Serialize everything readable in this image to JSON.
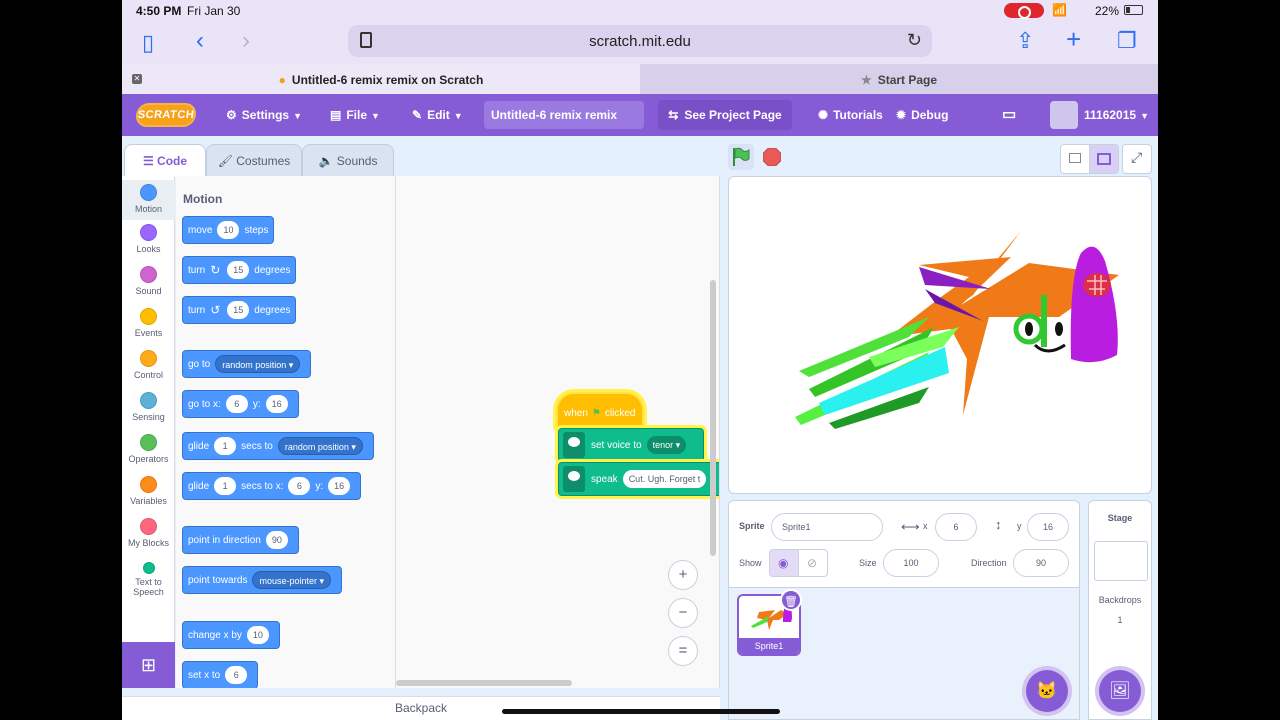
{
  "status": {
    "time": "4:50 PM",
    "date": "Fri Jan 30",
    "battery": "22%"
  },
  "browser": {
    "url": "scratch.mit.edu",
    "tabs": [
      {
        "label": "Untitled-6 remix remix on Scratch",
        "active": true
      },
      {
        "label": "Start Page",
        "active": false
      }
    ]
  },
  "menubar": {
    "logo": "SCRATCH",
    "settings": "Settings",
    "file": "File",
    "edit": "Edit",
    "project_title": "Untitled-6 remix remix",
    "see_project": "See Project Page",
    "tutorials": "Tutorials",
    "debug": "Debug",
    "username": "11162015"
  },
  "editor_tabs": {
    "code": "Code",
    "costumes": "Costumes",
    "sounds": "Sounds"
  },
  "categories": [
    {
      "label": "Motion",
      "color": "#4c97ff"
    },
    {
      "label": "Looks",
      "color": "#9966ff"
    },
    {
      "label": "Sound",
      "color": "#cf63cf"
    },
    {
      "label": "Events",
      "color": "#ffbf00"
    },
    {
      "label": "Control",
      "color": "#ffab19"
    },
    {
      "label": "Sensing",
      "color": "#5cb1d6"
    },
    {
      "label": "Operators",
      "color": "#59c059"
    },
    {
      "label": "Variables",
      "color": "#ff8c1a"
    },
    {
      "label": "My Blocks",
      "color": "#ff6680"
    },
    {
      "label": "Text to Speech",
      "color": "#0fbd8c"
    }
  ],
  "palette": {
    "heading": "Motion",
    "move": {
      "a": "move",
      "v": "10",
      "b": "steps"
    },
    "turn_right": {
      "a": "turn",
      "v": "15",
      "b": "degrees"
    },
    "turn_left": {
      "a": "turn",
      "v": "15",
      "b": "degrees"
    },
    "goto": {
      "a": "go to",
      "dd": "random position"
    },
    "gotoxy": {
      "a": "go to x:",
      "x": "6",
      "b": "y:",
      "y": "16"
    },
    "glide_to": {
      "a": "glide",
      "v": "1",
      "b": "secs to",
      "dd": "random position"
    },
    "glide_xy": {
      "a": "glide",
      "v": "1",
      "b": "secs to x:",
      "x": "6",
      "c": "y:",
      "y": "16"
    },
    "point_dir": {
      "a": "point in direction",
      "v": "90"
    },
    "point_towards": {
      "a": "point towards",
      "dd": "mouse-pointer"
    },
    "change_x": {
      "a": "change x by",
      "v": "10"
    },
    "set_x": {
      "a": "set x to",
      "v": "6"
    }
  },
  "script": {
    "hat_a": "when",
    "hat_b": "clicked",
    "voice_a": "set voice to",
    "voice_dd": "tenor",
    "speak_a": "speak",
    "speak_v": "Cut. Ugh. Forget t"
  },
  "zoom": {
    "in": "+",
    "out": "−",
    "reset": "="
  },
  "backpack": "Backpack",
  "sprite_info": {
    "sprite_label": "Sprite",
    "sprite_name": "Sprite1",
    "x_label": "x",
    "x": "6",
    "y_label": "y",
    "y": "16",
    "show_label": "Show",
    "size_label": "Size",
    "size": "100",
    "direction_label": "Direction",
    "direction": "90"
  },
  "sprite_list": {
    "sprite1": "Sprite1"
  },
  "stage_panel": {
    "heading": "Stage",
    "backdrops_label": "Backdrops",
    "backdrops_count": "1"
  },
  "colors": {
    "accent": "#855cd6",
    "motion": "#4c97ff",
    "events": "#ffbf00",
    "tts": "#0fbd8c"
  }
}
